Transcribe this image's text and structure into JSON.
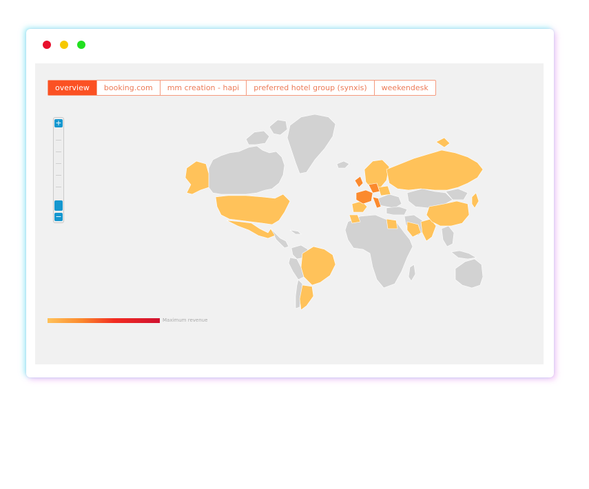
{
  "window": {
    "controls": [
      "close",
      "minimize",
      "maximize"
    ],
    "colors": {
      "close": "#e8102c",
      "minimize": "#f6c800",
      "maximize": "#22e020"
    }
  },
  "tabs": [
    {
      "label": "overview",
      "active": true
    },
    {
      "label": "booking.com",
      "active": false
    },
    {
      "label": "mm creation - hapi",
      "active": false
    },
    {
      "label": "preferred hotel group (synxis)",
      "active": false
    },
    {
      "label": "weekendesk",
      "active": false
    }
  ],
  "zoom": {
    "plus_label": "+",
    "minus_label": "−"
  },
  "legend": {
    "label": "Maximum revenue",
    "gradient": [
      "#ffc25a",
      "#fb8a2e",
      "#f22c22",
      "#d01230"
    ]
  },
  "colors": {
    "accent": "#fb5123",
    "no_revenue": "#d2d2d2",
    "low_revenue": "#ffc25a",
    "mid_revenue": "#fb8a2e",
    "panel_bg": "#f1f1f1",
    "zoom_button": "#1597cf"
  }
}
